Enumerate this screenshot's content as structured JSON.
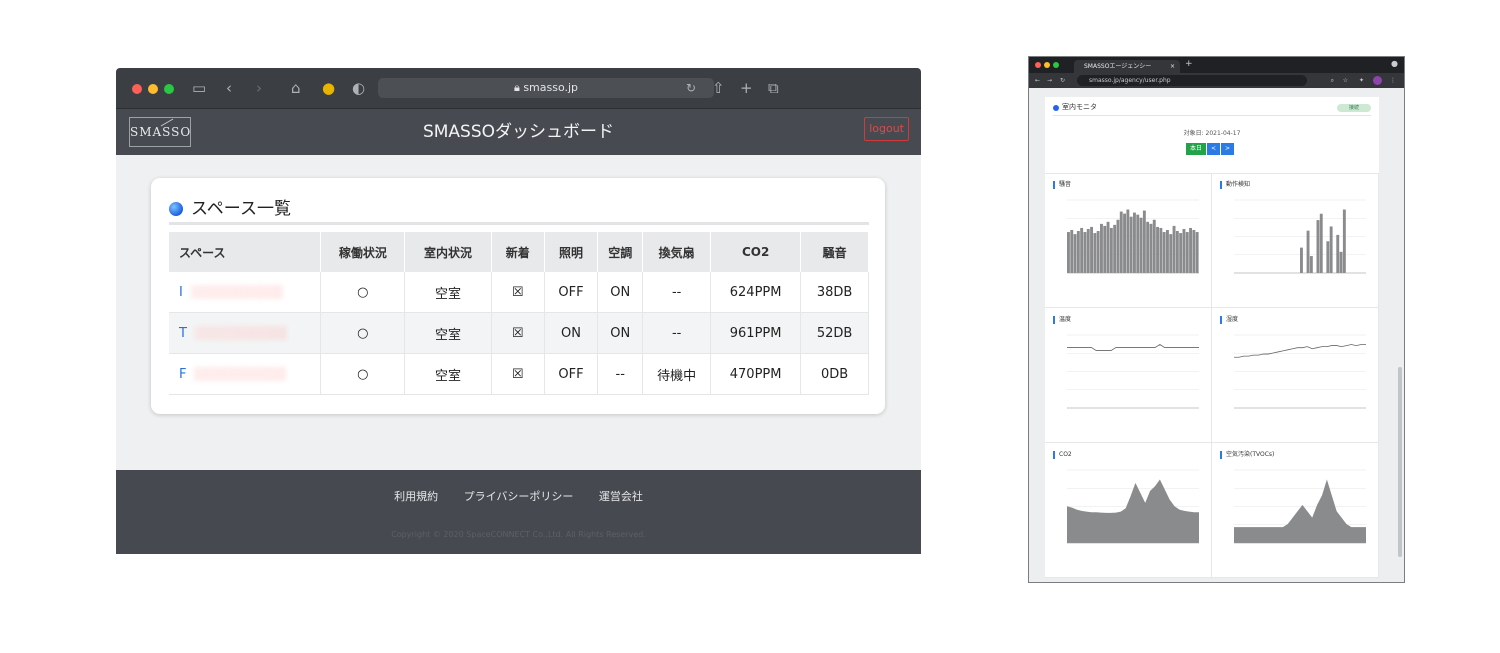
{
  "safari": {
    "url": "smasso.jp",
    "nav_logo": "SMASSO",
    "nav_title": "SMASSOダッシュボード",
    "logout_label": "logout",
    "card_title": "スペース一覧",
    "columns": [
      "スペース",
      "稼働状況",
      "室内状況",
      "新着",
      "照明",
      "空調",
      "換気扇",
      "CO2",
      "騒音"
    ],
    "rows": [
      {
        "space": "I",
        "status": "○",
        "room": "空室",
        "new": "☒",
        "light": "OFF",
        "ac": "ON",
        "fan": "--",
        "co2": "624PPM",
        "noise": "38DB"
      },
      {
        "space": "T",
        "status": "○",
        "room": "空室",
        "new": "☒",
        "light": "ON",
        "ac": "ON",
        "fan": "--",
        "co2": "961PPM",
        "noise": "52DB"
      },
      {
        "space": "F",
        "status": "○",
        "room": "空室",
        "new": "☒",
        "light": "OFF",
        "ac": "--",
        "fan": "待機中",
        "co2": "470PPM",
        "noise": "0DB"
      }
    ],
    "footer_links": [
      "利用規約",
      "プライバシーポリシー",
      "運営会社"
    ],
    "copyright": "Copyright © 2020 SpaceCONNECT Co.,Ltd. All Rights Reserved."
  },
  "chrome": {
    "tab_title": "SMASSOエージェンシー",
    "url": "smasso.jp/agency/user.php",
    "panel_title": "室内モニタ",
    "badge": "接続",
    "date_label": "対象日: 2021-04-17",
    "btn_today": "本日",
    "btn_prev": "<",
    "btn_next": ">",
    "charts": [
      {
        "label": "騒音",
        "type": "bar",
        "values": [
          40,
          42,
          38,
          41,
          44,
          40,
          43,
          45,
          39,
          41,
          48,
          46,
          50,
          44,
          47,
          52,
          60,
          58,
          62,
          55,
          59,
          57,
          54,
          61,
          50,
          48,
          52,
          45,
          44,
          40,
          42,
          38,
          46,
          41,
          39,
          43,
          40,
          44,
          42,
          40
        ]
      },
      {
        "label": "動作検知",
        "type": "bar",
        "values": [
          0,
          0,
          0,
          0,
          0,
          0,
          0,
          0,
          0,
          0,
          0,
          0,
          0,
          0,
          0,
          0,
          0,
          0,
          0,
          0,
          12,
          0,
          20,
          8,
          0,
          25,
          28,
          0,
          15,
          22,
          0,
          18,
          10,
          30,
          0,
          0,
          0,
          0,
          0,
          0
        ]
      },
      {
        "label": "温度",
        "type": "line",
        "values": [
          20,
          20,
          20,
          20,
          20,
          20,
          19,
          19,
          19,
          19,
          20,
          20,
          20,
          20,
          20,
          20,
          20,
          20,
          20,
          21,
          20,
          20,
          20,
          20,
          20,
          20,
          20,
          20
        ]
      },
      {
        "label": "湿度",
        "type": "line",
        "values": [
          48,
          48,
          49,
          49,
          50,
          50,
          51,
          51,
          52,
          53,
          54,
          55,
          56,
          57,
          57,
          58,
          56,
          57,
          58,
          58,
          59,
          59,
          58,
          59,
          60,
          59,
          60,
          60
        ]
      },
      {
        "label": "CO2",
        "type": "area",
        "values": [
          550,
          530,
          500,
          480,
          470,
          460,
          460,
          455,
          450,
          450,
          455,
          470,
          520,
          700,
          900,
          750,
          600,
          780,
          850,
          950,
          800,
          650,
          550,
          500,
          480,
          470,
          460,
          460
        ]
      },
      {
        "label": "空気汚染(TVOCs)",
        "type": "area",
        "values": [
          5,
          5,
          5,
          5,
          5,
          5,
          5,
          5,
          5,
          5,
          5,
          6,
          8,
          10,
          12,
          10,
          8,
          12,
          15,
          20,
          15,
          10,
          8,
          6,
          5,
          5,
          5,
          5
        ]
      }
    ]
  }
}
